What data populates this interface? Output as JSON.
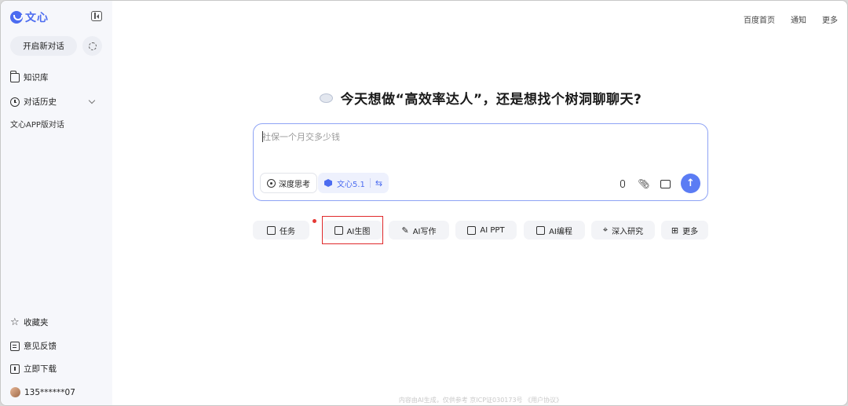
{
  "brand": {
    "logo_text": "文心"
  },
  "sidebar": {
    "new_chat_label": "开启新对话",
    "knowledge_base": "知识库",
    "history": "对话历史",
    "app_chat": "文心APP版对话",
    "favorites": "收藏夹",
    "feedback": "意见反馈",
    "download": "立即下载",
    "user": "135******07"
  },
  "top_links": [
    "百度首页",
    "通知",
    "更多"
  ],
  "headline": "今天想做“高效率达人”，还是想找个树洞聊聊天?",
  "input": {
    "value": "社保一个月交多少钱",
    "deep_think": "深度思考",
    "model": "文心5.1"
  },
  "chips": [
    "任务",
    "AI生图",
    "AI写作",
    "AI PPT",
    "AI编程",
    "深入研究",
    "更多"
  ],
  "footer": "内容由AI生成，仅供参考  京ICP证030173号  《用户协议》",
  "colors": {
    "accent": "#4c6cf0",
    "highlight": "#e0292b"
  }
}
